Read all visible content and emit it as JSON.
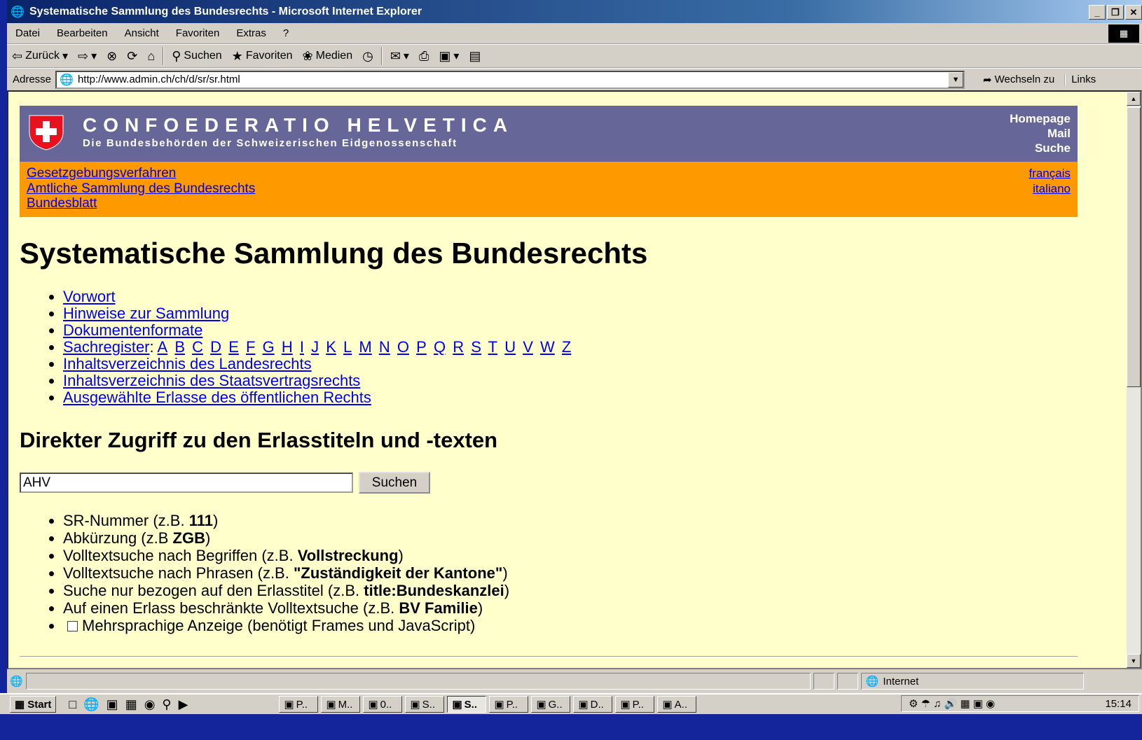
{
  "window": {
    "title": "Systematische Sammlung des Bundesrechts - Microsoft Internet Explorer",
    "buttons": [
      "_",
      "8",
      "✕"
    ]
  },
  "menu": [
    "Datei",
    "Bearbeiten",
    "Ansicht",
    "Favoriten",
    "Extras",
    "?"
  ],
  "toolbar": {
    "back": "Zurück",
    "search": "Suchen",
    "favorites": "Favoriten",
    "media": "Medien"
  },
  "address": {
    "label": "Adresse",
    "url": "http://www.admin.ch/ch/d/sr/sr.html",
    "go": "Wechseln zu",
    "links": "Links"
  },
  "banner": {
    "title": "CONFOEDERATIO HELVETICA",
    "subtitle": "Die Bundesbehörden der Schweizerischen Eidgenossenschaft",
    "links": [
      "Homepage",
      "Mail",
      "Suche"
    ]
  },
  "nav": {
    "left": [
      "Gesetzgebungsverfahren",
      "Amtliche Sammlung des Bundesrechts",
      "Bundesblatt"
    ],
    "right": [
      "français",
      "italiano"
    ]
  },
  "page": {
    "heading": "Systematische Sammlung des Bundesrechts",
    "links": {
      "vorwort": "Vorwort",
      "hinweise": "Hinweise zur Sammlung",
      "formate": "Dokumentenformate",
      "sachregister": "Sachregister",
      "landesrecht": "Inhaltsverzeichnis des Landesrechts",
      "staatsvertrag": "Inhaltsverzeichnis des Staatsvertragsrechts",
      "ausgewaehlt": "Ausgewählte Erlasse des öffentlichen Rechts"
    },
    "alphabet": [
      "A",
      "B",
      "C",
      "D",
      "E",
      "F",
      "G",
      "H",
      "I",
      "J",
      "K",
      "L",
      "M",
      "N",
      "O",
      "P",
      "Q",
      "R",
      "S",
      "T",
      "U",
      "V",
      "W",
      "Z"
    ],
    "subheading": "Direkter Zugriff zu den Erlasstiteln und -texten",
    "search_value": "AHV",
    "search_button": "Suchen",
    "hints": [
      {
        "pre": "SR-Nummer (z.B. ",
        "bold": "111",
        "post": ")"
      },
      {
        "pre": "Abkürzung (z.B ",
        "bold": "ZGB",
        "post": ")"
      },
      {
        "pre": "Volltextsuche nach Begriffen (z.B. ",
        "bold": "Vollstreckung",
        "post": ")"
      },
      {
        "pre": "Volltextsuche nach Phrasen (z.B. ",
        "bold": "\"Zuständigkeit der Kantone\"",
        "post": ")"
      },
      {
        "pre": "Suche nur bezogen auf den Erlasstitel (z.B. ",
        "bold": "title:Bundeskanzlei",
        "post": ")"
      },
      {
        "pre": "Auf einen Erlass beschränkte Volltextsuche (z.B. ",
        "bold": "BV Familie",
        "post": ")"
      }
    ],
    "multilang": "Mehrsprachige Anzeige (benötigt Frames und JavaScript)"
  },
  "status": {
    "zone": "Internet"
  },
  "taskbar": {
    "start": "Start",
    "tasks": [
      "P..",
      "M..",
      "0..",
      "S..",
      "S..",
      "P..",
      "G..",
      "D..",
      "P..",
      "A.."
    ],
    "active_task": "S..",
    "clock": "15:14"
  }
}
